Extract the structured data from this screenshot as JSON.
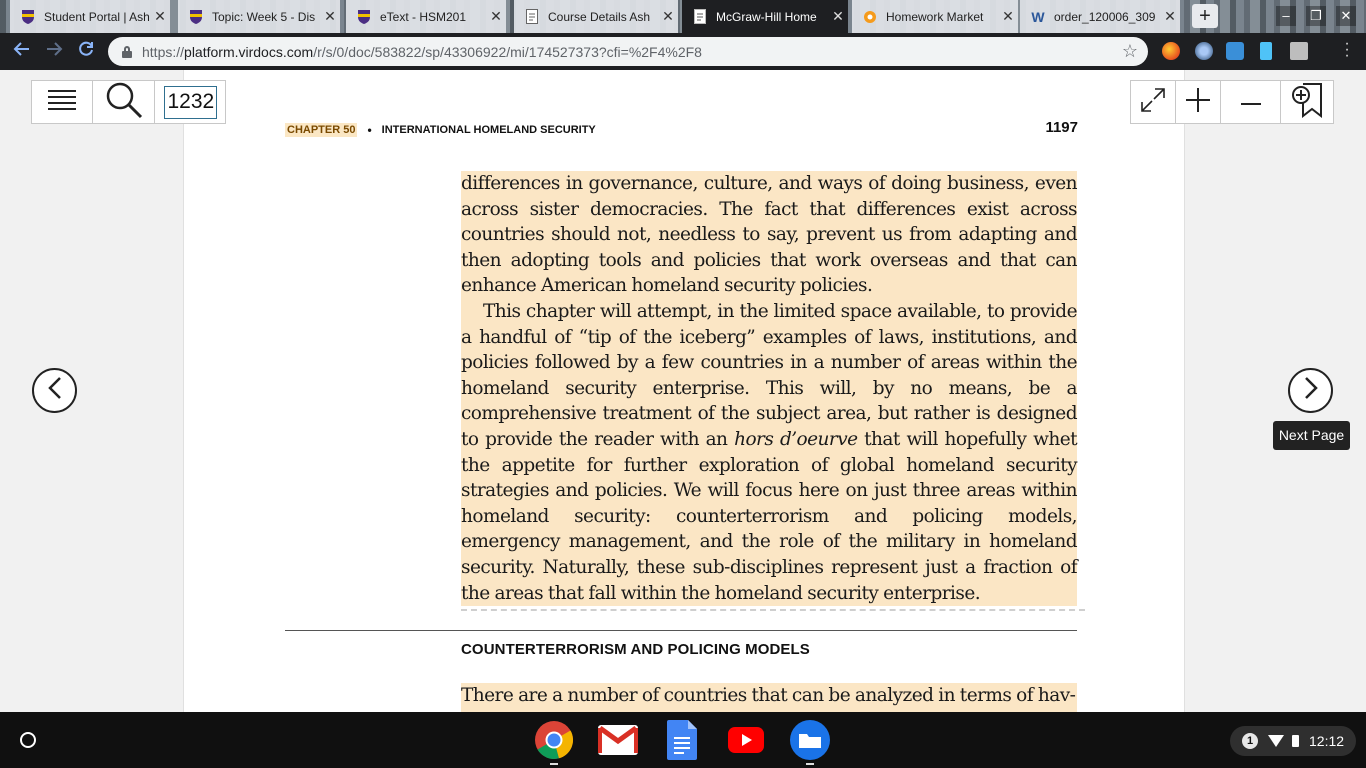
{
  "browser": {
    "tabs": [
      {
        "title": "Student Portal | Ash",
        "favicon": "shield-icon",
        "active": false
      },
      {
        "title": "Topic: Week 5 - Dis",
        "favicon": "shield-icon",
        "active": false
      },
      {
        "title": "eText - HSM201",
        "favicon": "shield-icon",
        "active": false
      },
      {
        "title": "Course Details Ash",
        "favicon": "document-icon",
        "active": false
      },
      {
        "title": "McGraw-Hill Home",
        "favicon": "document-icon",
        "active": true
      },
      {
        "title": "Homework Market",
        "favicon": "orange-circle-icon",
        "active": false
      },
      {
        "title": "order_120006_309",
        "favicon": "word-icon",
        "active": false
      }
    ],
    "url_prefix": "https://",
    "url_host": "platform.virdocs.com",
    "url_path": "/r/s/0/doc/583822/sp/43306922/mi/174527373?cfi=%2F4%2F8"
  },
  "reader": {
    "page_input": "1232",
    "tooltip": "Next Page"
  },
  "page": {
    "chapter_label": "CHAPTER 50",
    "bullet": "•",
    "running_title": "INTERNATIONAL HOMELAND SECURITY",
    "page_number": "1197",
    "para1": "differences in governance, culture, and ways of doing business, even across sister democracies. The fact that differences exist across countries should not, needless to say, prevent us from adapting and then adopting tools and policies that work overseas and that can enhance American homeland security policies.",
    "para2_a": "This chapter will attempt, in the limited space available, to provide a handful of “tip of the iceberg” examples of laws, institutions, and policies followed by a few countries in a number of areas within the homeland security enterprise. This will, by no means, be a comprehensive treatment of the subject area, but rather is designed to provide the reader with an ",
    "para2_em": "hors d’oeurve",
    "para2_b": " that will hopefully whet the appetite for further exploration of global homeland security strategies and policies. We will focus here on just three areas within homeland security: counterterrorism and policing models, emergency management, and the role of the military in homeland security. Naturally, these sub-disciplines represent just a fraction of the areas that fall within the homeland security enterprise.",
    "section_heading": "COUNTERTERRORISM AND POLICING MODELS",
    "para3": "There are a number of countries that can be analyzed in terms of hav-"
  },
  "shelf": {
    "apps": [
      "chrome-icon",
      "gmail-icon",
      "docs-icon",
      "youtube-icon",
      "files-icon"
    ],
    "notification_count": "1",
    "time": "12:12"
  }
}
